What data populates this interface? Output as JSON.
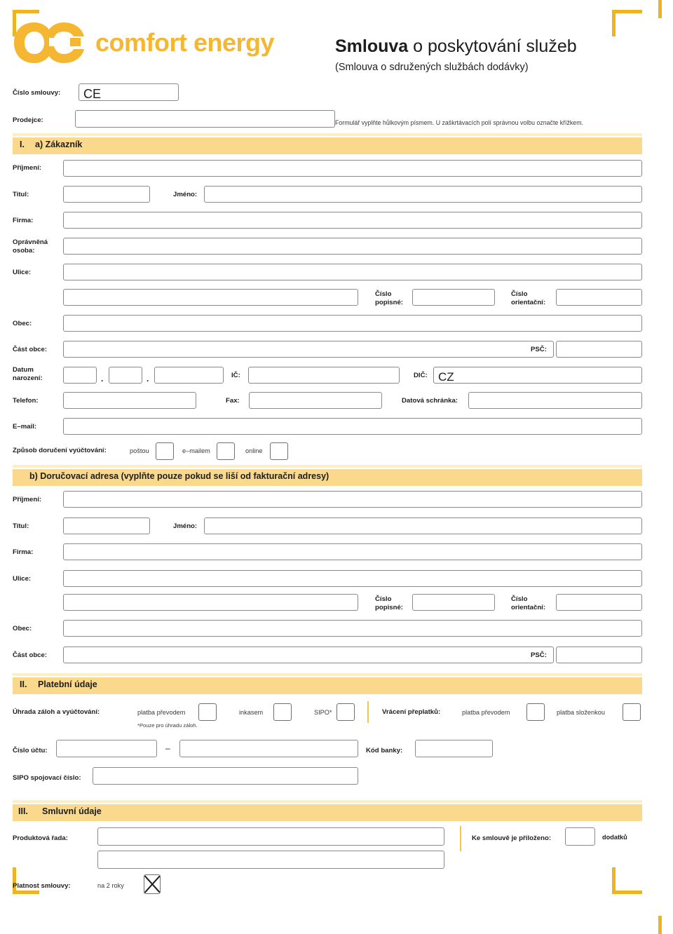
{
  "brand": {
    "name": "comfort energy",
    "logo_icon": "ce-monogram-logo",
    "accent_color": "#f5b731",
    "section_bar_color": "#fad98d"
  },
  "header": {
    "title_bold": "Smlouva",
    "title_rest": " o poskytování služeb",
    "subtitle": "(Smlouva o sdružených službách dodávky)",
    "instruction": "Formulář vyplňte hůlkovým písmem. U zaškrtávacích polí správnou volbu označte křížkem.",
    "contract_number_label": "Číslo smlouvy:",
    "contract_number_value": "CE",
    "seller_label": "Prodejce:",
    "seller_value": ""
  },
  "section_1": {
    "number": "I.",
    "title": "a) Zákazník",
    "fields": {
      "surname": "Příjmení:",
      "title_academic": "Titul:",
      "firstname": "Jméno:",
      "company": "Firma:",
      "authorized_person": "Oprávněná\nosoba:",
      "street": "Ulice:",
      "house_number": "Číslo\npopisné:",
      "orientation_number": "Číslo\norientační:",
      "municipality": "Obec:",
      "municipality_part": "Část obce:",
      "postal_code": "PSČ:",
      "birth_date": "Datum\nnarození:",
      "ico": "IČ:",
      "dic": "DIČ:",
      "dic_value": "CZ",
      "phone": "Telefon:",
      "fax": "Fax:",
      "data_box": "Datová schránka:",
      "email": "E–mail:"
    },
    "billing_delivery": {
      "label": "Způsob doručení vyúčtování:",
      "options": [
        {
          "label": "poštou",
          "checked": false
        },
        {
          "label": "e–mailem",
          "checked": false
        },
        {
          "label": "online",
          "checked": false
        }
      ]
    }
  },
  "section_1b": {
    "title": "b) Doručovací adresa (vyplňte pouze pokud se liší od fakturační adresy)",
    "fields": {
      "surname": "Příjmení:",
      "title_academic": "Titul:",
      "firstname": "Jméno:",
      "company": "Firma:",
      "street": "Ulice:",
      "house_number": "Číslo\npopisné:",
      "orientation_number": "Číslo\norientační:",
      "municipality": "Obec:",
      "municipality_part": "Část obce:",
      "postal_code": "PSČ:"
    }
  },
  "section_2": {
    "number": "II.",
    "title": "Platební údaje",
    "payment": {
      "label": "Úhrada záloh a vyúčtování:",
      "options": [
        {
          "label": "platba převodem",
          "checked": false
        },
        {
          "label": "inkasem",
          "checked": false
        },
        {
          "label": "SIPO*",
          "checked": false
        }
      ],
      "footnote": "*Pouze pro úhradu záloh."
    },
    "refund": {
      "label": "Vrácení přeplatků:",
      "options": [
        {
          "label": "platba převodem",
          "checked": false
        },
        {
          "label": "platba složenkou",
          "checked": false
        }
      ]
    },
    "account_number_label": "Číslo účtu:",
    "account_separator": "–",
    "bank_code_label": "Kód banky:",
    "sipo_label": "SIPO spojovací číslo:"
  },
  "section_3": {
    "number": "III.",
    "title": "Smluvní údaje",
    "product_line_label": "Produktová řada:",
    "appendix_label": "Ke smlouvě je přiloženo:",
    "appendix_suffix": "dodatků",
    "appendix_value": "",
    "validity_label": "Platnost smlouvy:",
    "validity_option": "na 2 roky",
    "validity_checked": true
  }
}
